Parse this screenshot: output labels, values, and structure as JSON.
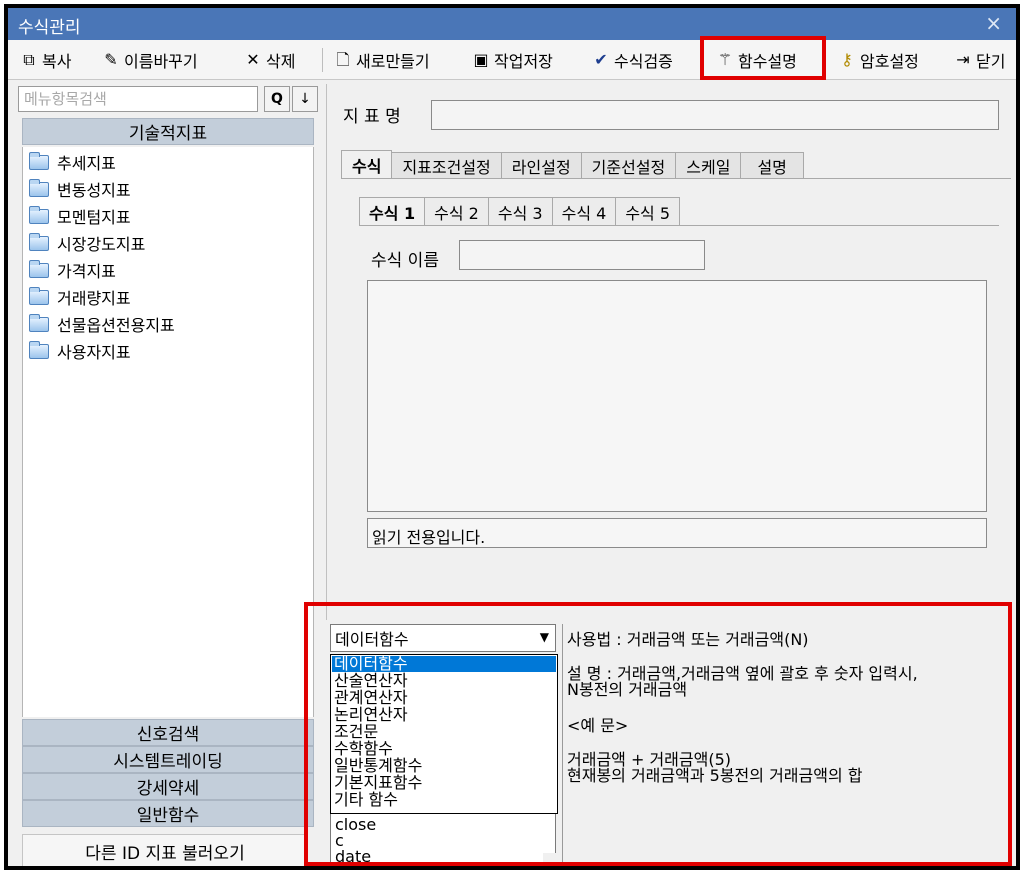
{
  "window": {
    "title": "수식관리",
    "close_label": "×"
  },
  "toolbar": {
    "copy": "복사",
    "rename": "이름바꾸기",
    "delete": "삭제",
    "new": "새로만들기",
    "save": "작업저장",
    "verify": "수식검증",
    "func_help": "함수설명",
    "password": "암호설정",
    "close": "닫기"
  },
  "left_panel": {
    "search_placeholder": "메뉴항목검색",
    "search_button": "Q",
    "down_button": "↓",
    "category_header": "기술적지표",
    "tree_items": [
      "추세지표",
      "변동성지표",
      "모멘텀지표",
      "시장강도지표",
      "가격지표",
      "거래량지표",
      "선물옵션전용지표",
      "사용자지표"
    ],
    "bottom_categories": [
      "신호검색",
      "시스템트레이딩",
      "강세약세",
      "일반함수"
    ],
    "load_button": "다른 ID 지표 불러오기"
  },
  "right_panel": {
    "indicator_name_label": "지 표 명",
    "indicator_name_value": "",
    "tabs": [
      "수식",
      "지표조건설정",
      "라인설정",
      "기준선설정",
      "스케일",
      "설명"
    ],
    "formula_tabs": [
      "수식 1",
      "수식 2",
      "수식 3",
      "수식 4",
      "수식 5"
    ],
    "formula_name_label": "수식 이름",
    "formula_name_value": "",
    "readonly_text": "읽기 전용입니다."
  },
  "function_helper": {
    "selected_category": "데이터함수",
    "dropdown_options": [
      "데이터함수",
      "산술연산자",
      "관계연산자",
      "논리연산자",
      "조건문",
      "수학함수",
      "일반통계함수",
      "기본지표함수",
      "기타 함수"
    ],
    "function_list_visible": [
      "close",
      "c",
      "date"
    ],
    "usage_line": "사용법 : 거래금액 또는 거래금액(N)",
    "desc_line1": "설    명 : 거래금액,거래금액 옆에 괄호 후 숫자 입력시,",
    "desc_line2": "N봉전의 거래금액",
    "example_header": "<예 문>",
    "example_line1": "거래금액 + 거래금액(5)",
    "example_line2": "현재봉의 거래금액과 5봉전의 거래금액의 합"
  },
  "colors": {
    "titlebar": "#4a76b7",
    "highlight_box": "#e00000",
    "selection": "#0078d7"
  }
}
